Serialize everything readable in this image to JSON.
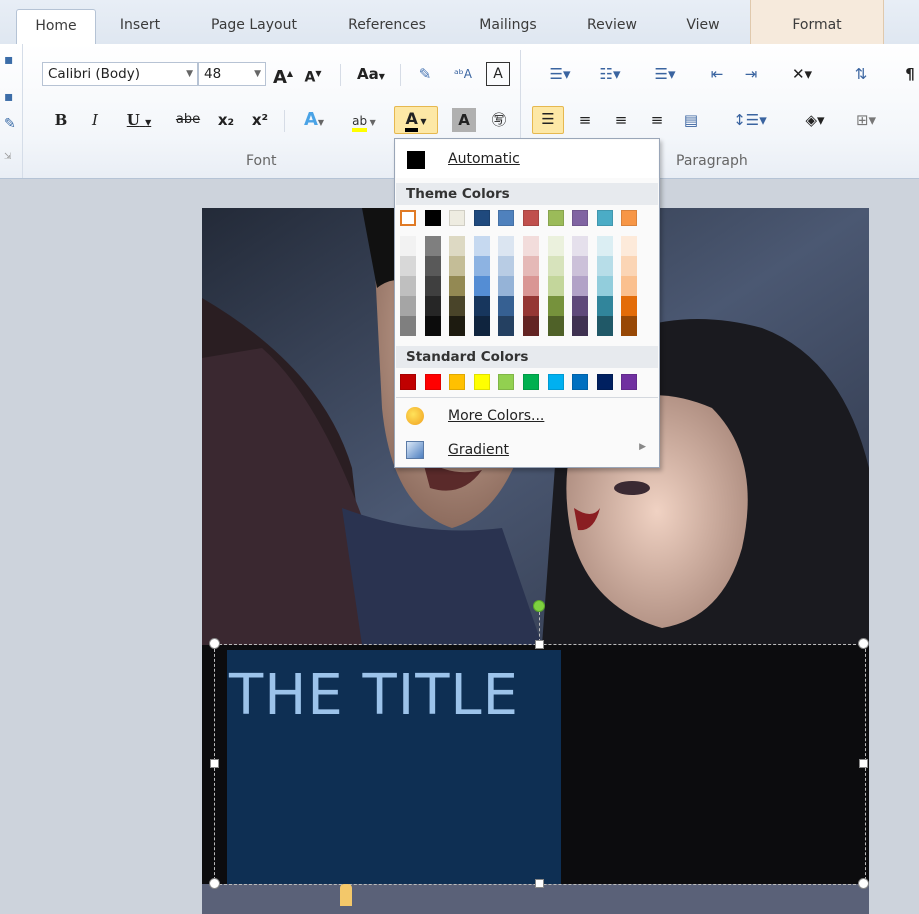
{
  "tabs": [
    {
      "label": "Home"
    },
    {
      "label": "Insert"
    },
    {
      "label": "Page Layout"
    },
    {
      "label": "References"
    },
    {
      "label": "Mailings"
    },
    {
      "label": "Review"
    },
    {
      "label": "View"
    },
    {
      "label": "Format"
    }
  ],
  "font": {
    "name": "Calibri (Body)",
    "size": "48",
    "group_label": "Font",
    "grow_label": "A",
    "shrink_label": "A",
    "case_label": "Aa",
    "bold_label": "B",
    "italic_label": "I",
    "underline_label": "U",
    "strike_label": "abe",
    "subscript_label": "x₂",
    "superscript_label": "x²",
    "font_color_label": "A",
    "highlight_label": "ab",
    "shading_label": "A"
  },
  "paragraph": {
    "group_label": "Paragraph",
    "pilcrow": "¶"
  },
  "dropdown": {
    "automatic_label": "Automatic",
    "theme_header": "Theme Colors",
    "standard_header": "Standard Colors",
    "more_colors_label": "More Colors...",
    "gradient_label": "Gradient",
    "theme_top": [
      "#ffffff",
      "#000000",
      "#eeece1",
      "#1f497d",
      "#4f81bd",
      "#c0504d",
      "#9bbb59",
      "#8064a2",
      "#4bacc6",
      "#f79646"
    ],
    "theme_tints": [
      [
        "#f2f2f2",
        "#d8d8d8",
        "#bfbfbf",
        "#a5a5a5",
        "#7f7f7f"
      ],
      [
        "#7f7f7f",
        "#595959",
        "#3f3f3f",
        "#262626",
        "#0c0c0c"
      ],
      [
        "#ddd9c3",
        "#c4bd97",
        "#938953",
        "#494429",
        "#1d1b10"
      ],
      [
        "#c6d9f0",
        "#8db3e2",
        "#548dd4",
        "#17365d",
        "#0f243e"
      ],
      [
        "#dbe5f1",
        "#b8cce4",
        "#95b3d7",
        "#366092",
        "#244061"
      ],
      [
        "#f2dcdb",
        "#e5b9b7",
        "#d99694",
        "#953734",
        "#632423"
      ],
      [
        "#ebf1dd",
        "#d7e3bc",
        "#c3d69b",
        "#76923c",
        "#4f6128"
      ],
      [
        "#e5e0ec",
        "#ccc1d9",
        "#b2a2c7",
        "#5f497a",
        "#3f3151"
      ],
      [
        "#dbeef3",
        "#b7dde8",
        "#92cddc",
        "#31859b",
        "#205867"
      ],
      [
        "#fdeada",
        "#fbd5b5",
        "#fac08f",
        "#e36c09",
        "#974806"
      ]
    ],
    "standard": [
      "#c00000",
      "#ff0000",
      "#ffc000",
      "#ffff00",
      "#92d050",
      "#00b050",
      "#00b0f0",
      "#0070c0",
      "#002060",
      "#7030a0"
    ]
  },
  "document": {
    "title_text": "THE TITLE",
    "title_color": "#9cc3ea",
    "box_color": "#0e2f53"
  }
}
